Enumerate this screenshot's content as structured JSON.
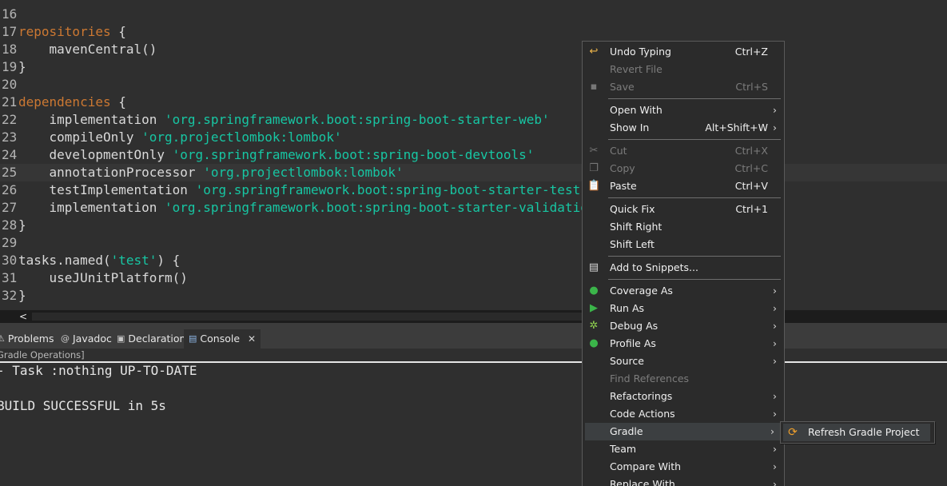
{
  "editor": {
    "lines": [
      {
        "num": "16",
        "segments": []
      },
      {
        "num": "17",
        "segments": [
          {
            "t": "repositories",
            "c": "kw"
          },
          {
            "t": " {",
            "c": "plain"
          }
        ]
      },
      {
        "num": "18",
        "segments": [
          {
            "t": "    mavenCentral()",
            "c": "plain"
          }
        ]
      },
      {
        "num": "19",
        "segments": [
          {
            "t": "}",
            "c": "plain"
          }
        ]
      },
      {
        "num": "20",
        "segments": []
      },
      {
        "num": "21",
        "segments": [
          {
            "t": "dependencies",
            "c": "kw"
          },
          {
            "t": " {",
            "c": "plain"
          }
        ]
      },
      {
        "num": "22",
        "segments": [
          {
            "t": "    implementation ",
            "c": "plain"
          },
          {
            "t": "'org.springframework.boot:spring-boot-starter-web'",
            "c": "str"
          }
        ]
      },
      {
        "num": "23",
        "segments": [
          {
            "t": "    compileOnly ",
            "c": "plain"
          },
          {
            "t": "'org.projectlombok:lombok'",
            "c": "str"
          }
        ]
      },
      {
        "num": "24",
        "segments": [
          {
            "t": "    developmentOnly ",
            "c": "plain"
          },
          {
            "t": "'org.springframework.boot:spring-boot-devtools'",
            "c": "str"
          }
        ]
      },
      {
        "num": "25",
        "segments": [
          {
            "t": "    annotationProcessor ",
            "c": "plain"
          },
          {
            "t": "'org.projectlombok:lombok'",
            "c": "str"
          }
        ],
        "current": true
      },
      {
        "num": "26",
        "segments": [
          {
            "t": "    testImplementation ",
            "c": "plain"
          },
          {
            "t": "'org.springframework.boot:spring-boot-starter-test'",
            "c": "str"
          }
        ]
      },
      {
        "num": "27",
        "segments": [
          {
            "t": "    implementation ",
            "c": "plain"
          },
          {
            "t": "'org.springframework.boot:spring-boot-starter-validation'",
            "c": "str"
          }
        ]
      },
      {
        "num": "28",
        "segments": [
          {
            "t": "}",
            "c": "plain"
          }
        ]
      },
      {
        "num": "29",
        "segments": []
      },
      {
        "num": "30",
        "segments": [
          {
            "t": "tasks.named(",
            "c": "plain"
          },
          {
            "t": "'test'",
            "c": "str"
          },
          {
            "t": ") {",
            "c": "plain"
          }
        ]
      },
      {
        "num": "31",
        "segments": [
          {
            "t": "    useJUnitPlatform()",
            "c": "plain"
          }
        ]
      },
      {
        "num": "32",
        "segments": [
          {
            "t": "}",
            "c": "plain"
          }
        ]
      }
    ]
  },
  "scroll": {
    "left_arrow": "<"
  },
  "tabs": {
    "problems": "Problems",
    "javadoc": "Javadoc",
    "declaration": "Declaration",
    "console": "Console",
    "close": "✕"
  },
  "console": {
    "title": "Gradle Operations]",
    "lines": [
      "- Task :nothing UP-TO-DATE",
      "",
      "BUILD SUCCESSFUL in 5s"
    ]
  },
  "menu": {
    "items": [
      {
        "label": "Undo Typing",
        "acc": "Ctrl+Z",
        "icon": "undo-icon",
        "glyph": "↩",
        "color": "#f2b84b"
      },
      {
        "label": "Revert File",
        "disabled": true
      },
      {
        "label": "Save",
        "acc": "Ctrl+S",
        "disabled": true,
        "icon": "save-icon",
        "glyph": "▪",
        "color": "#777777"
      },
      {
        "sep": true
      },
      {
        "label": "Open With",
        "sub": true
      },
      {
        "label": "Show In",
        "acc": "Alt+Shift+W",
        "sub": true
      },
      {
        "sep": true
      },
      {
        "label": "Cut",
        "acc": "Ctrl+X",
        "disabled": true,
        "icon": "cut-icon",
        "glyph": "✂",
        "color": "#777777"
      },
      {
        "label": "Copy",
        "acc": "Ctrl+C",
        "disabled": true,
        "icon": "copy-icon",
        "glyph": "❐",
        "color": "#777777"
      },
      {
        "label": "Paste",
        "acc": "Ctrl+V",
        "icon": "paste-icon",
        "glyph": "📋",
        "color": "#e0c070"
      },
      {
        "sep": true
      },
      {
        "label": "Quick Fix",
        "acc": "Ctrl+1"
      },
      {
        "label": "Shift Right"
      },
      {
        "label": "Shift Left"
      },
      {
        "sep": true
      },
      {
        "label": "Add to Snippets...",
        "icon": "snippet-icon",
        "glyph": "▤",
        "color": "#d8d8d8"
      },
      {
        "sep": true
      },
      {
        "label": "Coverage As",
        "sub": true,
        "icon": "coverage-icon",
        "glyph": "●",
        "color": "#3bb54a"
      },
      {
        "label": "Run As",
        "sub": true,
        "icon": "run-icon",
        "glyph": "▶",
        "color": "#3bb54a"
      },
      {
        "label": "Debug As",
        "sub": true,
        "icon": "debug-icon",
        "glyph": "✲",
        "color": "#8fd14f"
      },
      {
        "label": "Profile As",
        "sub": true,
        "icon": "profile-icon",
        "glyph": "●",
        "color": "#3bb54a"
      },
      {
        "label": "Source",
        "sub": true
      },
      {
        "label": "Find References",
        "disabled": true
      },
      {
        "label": "Refactorings",
        "sub": true
      },
      {
        "label": "Code Actions",
        "sub": true
      },
      {
        "label": "Gradle",
        "sub": true,
        "highlight": true
      },
      {
        "label": "Team",
        "sub": true
      },
      {
        "label": "Compare With",
        "sub": true
      },
      {
        "label": "Replace With",
        "sub": true
      }
    ],
    "submenu_arrow": "›"
  },
  "submenu": {
    "label": "Refresh Gradle Project",
    "icon": "refresh-icon",
    "glyph": "⟳"
  }
}
